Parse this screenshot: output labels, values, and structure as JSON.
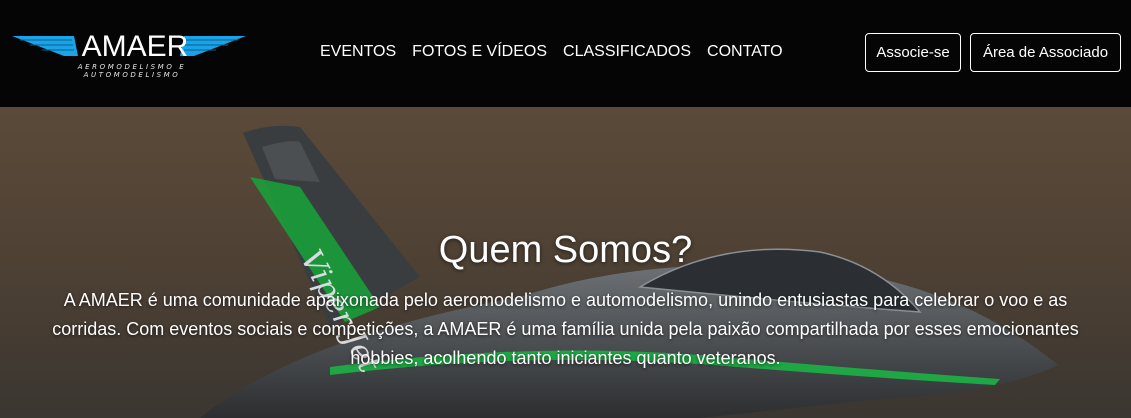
{
  "brand": {
    "name": "AMAER",
    "tagline": "AEROMODELISMO E AUTOMODELISMO",
    "wing_color": "#1aa3e8"
  },
  "nav": {
    "items": [
      "EVENTOS",
      "FOTOS E VÍDEOS",
      "CLASSIFICADOS",
      "CONTATO"
    ]
  },
  "actions": {
    "join_label": "Associe-se",
    "member_area_label": "Área de Associado"
  },
  "hero": {
    "title": "Quem Somos?",
    "text": "A AMAER é uma comunidade apaixonada pelo aeromodelismo e automodelismo, unindo entusiastas para celebrar o voo e as corridas. Com eventos sociais e competições, a AMAER é uma família unida pela paixão compartilhada por esses emocionantes hobbies, acolhendo tanto iniciantes quanto veteranos.",
    "jet_tail_text": "Viper Jet"
  }
}
